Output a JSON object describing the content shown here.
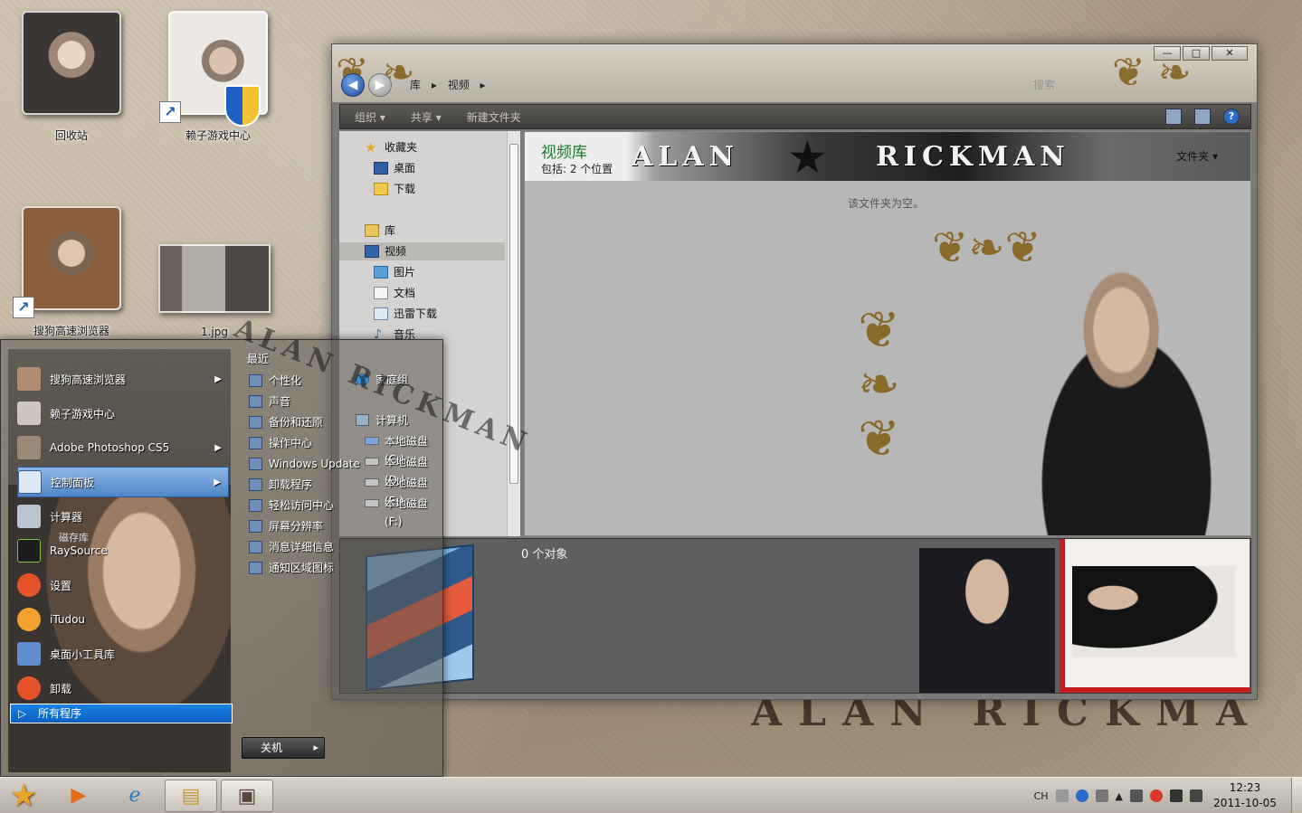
{
  "desktop": {
    "icons": [
      {
        "label": "回收站"
      },
      {
        "label": "赖子游戏中心"
      },
      {
        "label": "搜狗高速浏览器"
      },
      {
        "label": "1.jpg"
      }
    ],
    "wallpaper_script": "ALAN RICKMAN"
  },
  "explorer": {
    "breadcrumb": [
      "库",
      "视频"
    ],
    "search_placeholder": "搜索",
    "window_controls": {
      "minimize": "—",
      "maximize": "□",
      "close": "✕"
    },
    "toolbar": {
      "organize": "组织",
      "share": "共享",
      "new_folder": "新建文件夹"
    },
    "nav": {
      "favorites": "收藏夹",
      "desktop": "桌面",
      "downloads": "下载",
      "libraries": "库",
      "video": "视频",
      "pictures": "图片",
      "documents": "文档",
      "xunlei": "迅雷下载",
      "music": "音乐"
    },
    "library_title": "视频库",
    "library_subtitle": "包括: 2 个位置",
    "banner_text_left": "ALAN",
    "banner_text_right": "RICKMAN",
    "arrange_by": "文件夹",
    "empty_message": "该文件夹为空。",
    "details_count": "0 个对象"
  },
  "start_menu": {
    "programs": [
      {
        "label": "搜狗高速浏览器",
        "has_submenu": true
      },
      {
        "label": "赖子游戏中心",
        "has_submenu": false
      },
      {
        "label": "Adobe Photoshop CS5",
        "has_submenu": true
      },
      {
        "label": "控制面板",
        "has_submenu": true
      },
      {
        "label": "计算器",
        "has_submenu": false
      },
      {
        "label": "RaySource",
        "has_submenu": false
      },
      {
        "label": "设置",
        "has_submenu": false
      },
      {
        "label": "iTudou",
        "has_submenu": false
      },
      {
        "label": "桌面小工具库",
        "has_submenu": false
      },
      {
        "label": "卸载",
        "has_submenu": false
      }
    ],
    "program_sub_note": "磁存库",
    "all_programs": "所有程序",
    "recent_title": "最近",
    "recent": [
      "个性化",
      "声音",
      "备份和还原",
      "操作中心",
      "Windows Update",
      "卸载程序",
      "轻松访问中心",
      "屏幕分辨率",
      "消息详细信息",
      "通知区域图标"
    ],
    "places": {
      "homegroup": "家庭组",
      "computer": "计算机"
    },
    "drives": [
      "本地磁盘 (C:)",
      "本地磁盘 (D:)",
      "本地磁盘 (E:)",
      "本地磁盘 (F:)"
    ],
    "signature": "ALAN RICKMAN",
    "shutdown": "关机"
  },
  "taskbar": {
    "language": "CH",
    "time": "12:23",
    "date": "2011-10-05"
  },
  "colors": {
    "accent": "#1b82e3",
    "library_title": "#1a7a2c",
    "gift_ribbon": "#c41d1d"
  }
}
